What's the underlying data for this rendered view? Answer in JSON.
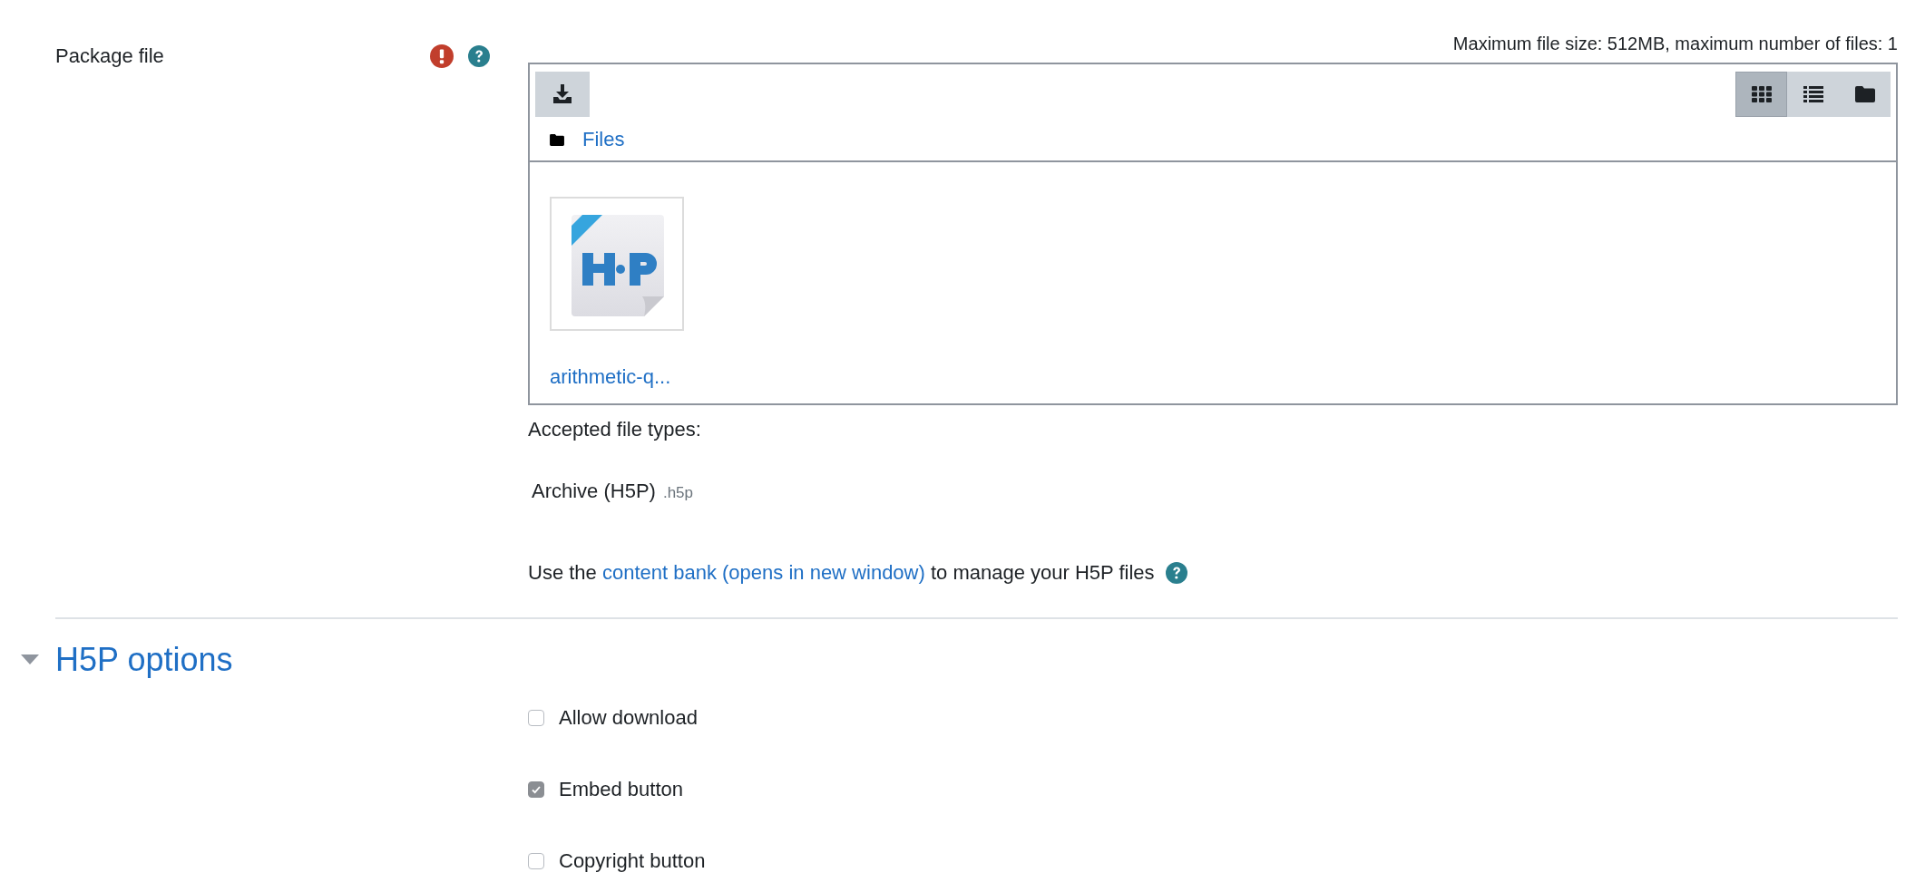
{
  "field": {
    "label": "Package file",
    "required": true,
    "help": true
  },
  "filemanager": {
    "limits": "Maximum file size: 512MB, maximum number of files: 1",
    "views": [
      {
        "kind": "grid",
        "selected": true
      },
      {
        "kind": "list",
        "selected": false
      },
      {
        "kind": "tree",
        "selected": false
      }
    ],
    "path": "Files",
    "files": [
      {
        "name": "arithmetic-q..."
      }
    ]
  },
  "accepted_label": "Accepted file types:",
  "file_types": [
    {
      "name": "Archive (H5P)",
      "extension": ".h5p"
    }
  ],
  "content_bank": {
    "before": "Use the",
    "link": "content bank (opens in new window)",
    "after": "to manage your H5P files"
  },
  "section": {
    "title": "H5P options",
    "expanded": true
  },
  "options": [
    {
      "label": "Allow download",
      "checked": false
    },
    {
      "label": "Embed button",
      "checked": true
    },
    {
      "label": "Copyright button",
      "checked": false
    }
  ]
}
